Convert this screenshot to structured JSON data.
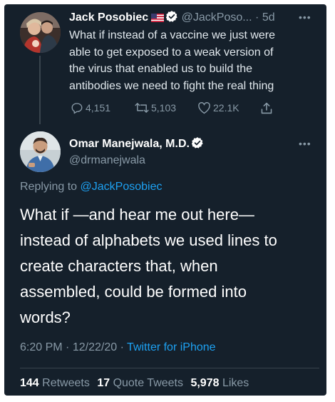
{
  "parent_tweet": {
    "display_name": "Jack Posobiec",
    "flag_icon": "us-flag-icon",
    "verified_icon": "verified-badge-icon",
    "handle": "@JackPoso...",
    "separator": "·",
    "time_ago": "5d",
    "more_icon": "more-dots-icon",
    "text_lines": [
      "What if instead of a vaccine we just were",
      "able to get exposed to a weak version of",
      "the virus that enabled us to build the",
      "antibodies we need to fight the real thing"
    ],
    "replies": "4,151",
    "retweets": "5,103",
    "likes": "22.1K",
    "reply_icon": "reply-bubble-icon",
    "retweet_icon": "retweet-icon",
    "like_icon": "heart-icon",
    "share_icon": "share-icon"
  },
  "main_tweet": {
    "display_name": "Omar Manejwala, M.D.",
    "verified_icon": "verified-badge-icon",
    "handle": "@drmanejwala",
    "more_icon": "more-dots-icon",
    "replying_prefix": "Replying to",
    "replying_to": "@JackPosobiec",
    "text_lines": [
      "What if —and hear me out here—",
      "instead of alphabets we used lines to",
      "create characters that, when",
      "assembled, could be formed into",
      "words?"
    ],
    "time": "6:20 PM",
    "date": "12/22/20",
    "meta_separator": "·",
    "source": "Twitter for iPhone",
    "retweets_count": "144",
    "retweets_label": "Retweets",
    "quote_count": "17",
    "quote_label": "Quote Tweets",
    "likes_count": "5,978",
    "likes_label": "Likes"
  },
  "colors": {
    "background": "#15202b",
    "primary_text": "#ffffff",
    "secondary_text": "#8899a6",
    "link": "#1da1f2",
    "divider": "#38444d"
  }
}
